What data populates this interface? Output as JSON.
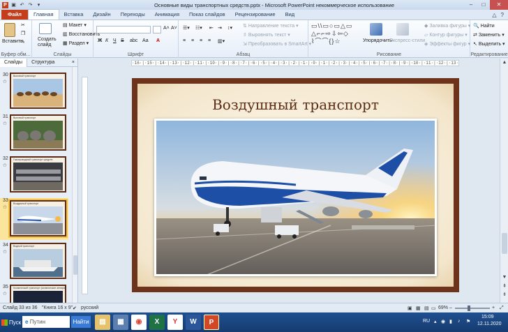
{
  "window": {
    "title": "Основные виды транспортных средств.pptx  -  Microsoft PowerPoint некоммерческое использование",
    "minimize": "–",
    "maximize": "□",
    "close": "✕"
  },
  "ribbon_tabs": [
    "Файл",
    "Главная",
    "Вставка",
    "Дизайн",
    "Переходы",
    "Анимация",
    "Показ слайдов",
    "Рецензирование",
    "Вид"
  ],
  "ribbon": {
    "clipboard": {
      "paste": "Вставить",
      "label": "Буфер обм..."
    },
    "slides": {
      "new_slide": "Создать слайд",
      "layout": "Макет",
      "reset": "Восстановить",
      "section": "Раздел",
      "label": "Слайды"
    },
    "font": {
      "label": "Шрифт",
      "bold": "Ж",
      "italic": "К",
      "underline": "Ч",
      "strike": "S",
      "spacing": "abc",
      "aa": "Аа"
    },
    "paragraph": {
      "text_direction": "Направление текста",
      "align_text": "Выровнять текст",
      "smartart": "Преобразовать в SmartArt",
      "label": "Абзац"
    },
    "drawing": {
      "arrange": "Упорядочить",
      "quick_styles": "Экспресс-стили",
      "shape_fill": "Заливка фигуры",
      "shape_outline": "Контур фигуры",
      "shape_effects": "Эффекты фигур",
      "label": "Рисование"
    },
    "editing": {
      "find": "Найти",
      "replace": "Заменить",
      "select": "Выделить",
      "label": "Редактирование"
    }
  },
  "left_pane": {
    "tabs": [
      "Слайды",
      "Структура"
    ],
    "close": "×",
    "thumbnails": [
      {
        "number": "30",
        "title": "Вьючный транспорт",
        "scene": "camels"
      },
      {
        "number": "31",
        "title": "Вьючный транспорт",
        "scene": "elephants"
      },
      {
        "number": "32",
        "title": "Газопроводный транспорт средств",
        "scene": "pipeline"
      },
      {
        "number": "33",
        "title": "Воздушный транспорт",
        "scene": "plane"
      },
      {
        "number": "34",
        "title": "Водный транспорт",
        "scene": "ship"
      },
      {
        "number": "35",
        "title": "Космический транспорт (космические аппараты)",
        "scene": "space"
      }
    ]
  },
  "ruler_text": "·16·|·15·|·14·|·13·|·12·|·11·|·10·|·9·|·8·|·7·|·6·|·5·|·4·|·3·|·2·|·1·|·0·|·1·|·2·|·3·|·4·|·5·|·6·|·7·|·8·|·9·|·10·|·11·|·12·|·13·|·14·|·15·|·16·",
  "slide": {
    "title": "Воздушный транспорт",
    "photo_caption": "aircraft photo"
  },
  "status": {
    "slide_info": "Слайд 33 из 36",
    "theme": "\"Книга 16 x 9\"",
    "language": "русский",
    "zoom": "69%",
    "zoom_minus": "–",
    "zoom_plus": "+"
  },
  "taskbar": {
    "start": "Пуск",
    "search": "Путин",
    "find": "Найти",
    "lang": "RU",
    "time": "15:09",
    "date": "12.11.2020"
  },
  "colors": {
    "slide_frame": "#6e341b",
    "slide_title": "#5a2c16",
    "file_tab": "#c43e1c",
    "taskbar": "#1f4f8f"
  }
}
